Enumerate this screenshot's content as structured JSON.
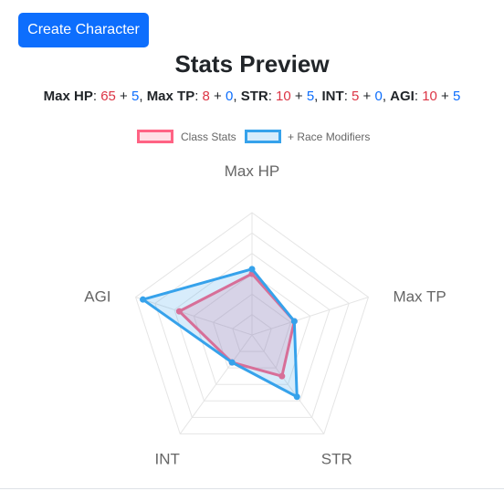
{
  "create_button": {
    "label": "Create Character"
  },
  "heading": "Stats Preview",
  "stats_summary": [
    {
      "label": "Max HP",
      "base": "65",
      "modifier": "5"
    },
    {
      "label": "Max TP",
      "base": "8",
      "modifier": "0"
    },
    {
      "label": "STR",
      "base": "10",
      "modifier": "5"
    },
    {
      "label": "INT",
      "base": "5",
      "modifier": "0"
    },
    {
      "label": "AGI",
      "base": "10",
      "modifier": "5"
    }
  ],
  "chart_data": {
    "type": "radar",
    "categories": [
      "Max HP",
      "Max TP",
      "STR",
      "INT",
      "AGI"
    ],
    "series": [
      {
        "name": "Class Stats",
        "values": [
          65,
          8,
          10,
          5,
          10
        ],
        "color": "#ff6384",
        "fill": "rgba(255,99,132,0.2)"
      },
      {
        "name": "+ Race Modifiers",
        "values": [
          70,
          8,
          15,
          5,
          15
        ],
        "color": "#36a2eb",
        "fill": "rgba(54,162,235,0.2)"
      }
    ],
    "scale_per_axis": {
      "Max HP": 130,
      "Max TP": 22,
      "STR": 24,
      "INT": 18,
      "AGI": 16
    },
    "ring_count": 6,
    "legend_position": "top",
    "grid_color": "#e5e5e5"
  }
}
